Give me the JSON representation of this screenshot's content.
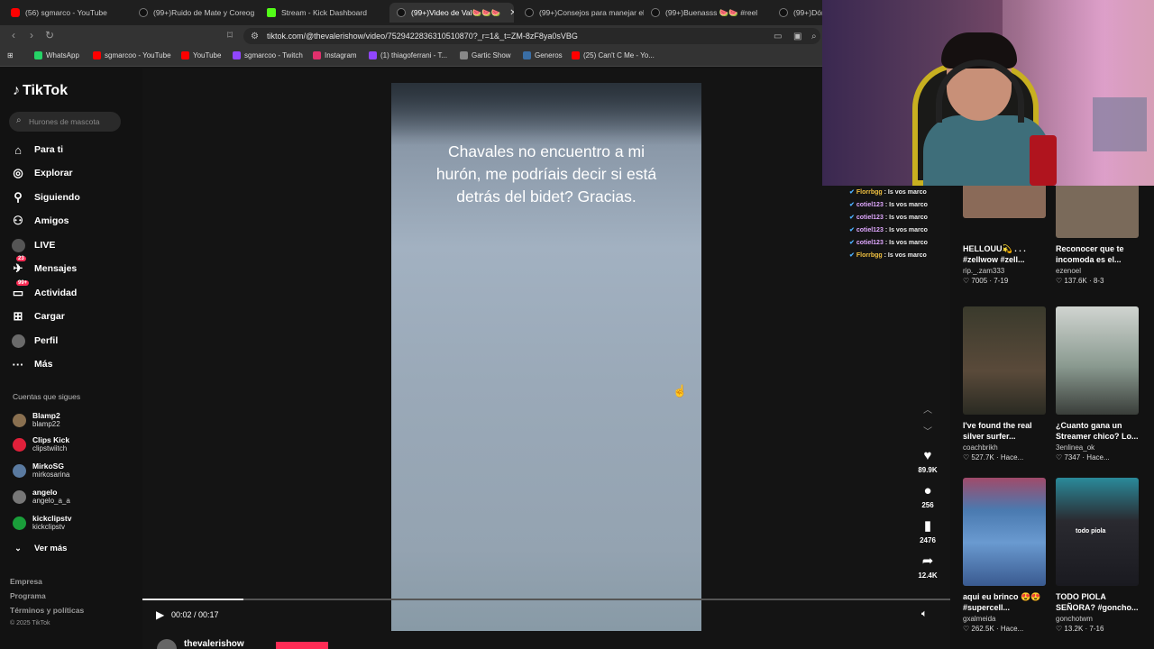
{
  "browser": {
    "tabs": [
      {
        "label": "(56) sgmarco - YouTube",
        "icon": "youtube-icon"
      },
      {
        "label": "(99+)Ruido de Mate y Coreog",
        "icon": "tiktok-icon"
      },
      {
        "label": "Stream - Kick Dashboard",
        "icon": "kick-icon"
      },
      {
        "label": "(99+)Video de Val🍉🍉🍉",
        "icon": "tiktok-icon",
        "active": true
      },
      {
        "label": "(99+)Consejos para manejar el",
        "icon": "tiktok-icon"
      },
      {
        "label": "(99+)Buenasss 🍉🍉 #reel",
        "icon": "tiktok-icon"
      },
      {
        "label": "(99+)Dór",
        "icon": "tiktok-icon"
      }
    ],
    "url": "tiktok.com/@thevalerishow/video/7529422836310510870?_r=1&_t=ZM-8zF8ya0sVBG",
    "bookmarks": [
      {
        "label": "WhatsApp",
        "color": "#25d366"
      },
      {
        "label": "sgmarcoo - YouTube",
        "color": "#ff0000"
      },
      {
        "label": "YouTube",
        "color": "#ff0000"
      },
      {
        "label": "sgmarcoo - Twitch",
        "color": "#9146ff"
      },
      {
        "label": "Instagram",
        "color": "#e1306c"
      },
      {
        "label": "(1) thiagoferrani - T...",
        "color": "#9146ff"
      },
      {
        "label": "Gartic Show",
        "color": "#888888"
      },
      {
        "label": "Generos",
        "color": "#3a6ea5"
      },
      {
        "label": "(25) Can't C Me - Yo...",
        "color": "#ff0000"
      }
    ]
  },
  "sidebar": {
    "logo": "TikTok",
    "search_placeholder": "Hurones de mascota",
    "nav": [
      {
        "label": "Para ti",
        "icon": "home-icon"
      },
      {
        "label": "Explorar",
        "icon": "compass-icon"
      },
      {
        "label": "Siguiendo",
        "icon": "person-plus-icon"
      },
      {
        "label": "Amigos",
        "icon": "friends-icon"
      },
      {
        "label": "LIVE",
        "icon": "live-icon"
      },
      {
        "label": "Mensajes",
        "icon": "message-icon",
        "badge": "23"
      },
      {
        "label": "Actividad",
        "icon": "inbox-icon",
        "badge": "99+"
      },
      {
        "label": "Cargar",
        "icon": "plus-box-icon"
      },
      {
        "label": "Perfil",
        "icon": "profile-avatar"
      },
      {
        "label": "Más",
        "icon": "ellipsis-icon"
      }
    ],
    "following_title": "Cuentas que sigues",
    "following": [
      {
        "name": "Blamp2",
        "handle": "blamp22",
        "color": "#8a7050"
      },
      {
        "name": "Clips Kick",
        "handle": "clipstwiitch",
        "color": "#e0203a"
      },
      {
        "name": "MirkoSG",
        "handle": "mirkosarina",
        "color": "#5a7aa0"
      },
      {
        "name": "angelo",
        "handle": "angelo_a_a",
        "color": "#777777"
      },
      {
        "name": "kickclipstv",
        "handle": "kickclipstv",
        "color": "#1a9e3a"
      }
    ],
    "see_more": "Ver más",
    "footer": [
      "Empresa",
      "Programa",
      "Términos y políticas",
      "© 2025 TikTok"
    ]
  },
  "video": {
    "caption": "Chavales no encuentro a mi hurón, me podríais decir si está detrás del bidet? Gracias.",
    "time": "00:02 / 00:17",
    "progress": 0.125,
    "author": "thevalerishow",
    "actions": {
      "likes": "89.9K",
      "comments": "256",
      "saves": "2476",
      "shares": "12.4K"
    }
  },
  "chat": [
    {
      "user": "Florrbgg",
      "msg": ": Is vos marco",
      "gold": true
    },
    {
      "user": "cotiel123",
      "msg": ": Is vos marco",
      "gold": false
    },
    {
      "user": "cotiel123",
      "msg": ": Is vos marco",
      "gold": false
    },
    {
      "user": "cotiel123",
      "msg": ": Is vos marco",
      "gold": false
    },
    {
      "user": "cotiel123",
      "msg": ": Is vos marco",
      "gold": false
    },
    {
      "user": "Florrbgg",
      "msg": ": Is vos marco",
      "gold": true
    }
  ],
  "related": [
    {
      "title": "HELLOUU💫 . . . #zellwow #zell...",
      "author": "rip._.zam333",
      "stats": "♡ 7005 · 7-19",
      "bg": "#8a6a58"
    },
    {
      "title": "Reconocer que te incomoda es el...",
      "author": "ezenoel",
      "stats": "♡ 137.6K · 8-3",
      "bg": "#7a6a5a"
    },
    {
      "title": "I've found the real silver surfer...",
      "author": "coachbrikh",
      "stats": "♡ 527.7K · Hace...",
      "bg": "#3a3a2c"
    },
    {
      "title": "¿Cuanto gana un Streamer chico? Lo...",
      "author": "3enlinea_ok",
      "stats": "♡ 7347 · Hace...",
      "bg": "#bfc3c0"
    },
    {
      "title": "aqui eu brinco 😍😍 #supercell...",
      "author": "gxalmeida",
      "stats": "♡ 262.5K · Hace...",
      "bg": "#4a7ab0"
    },
    {
      "title": "TODO PIOLA SEÑORA? #goncho...",
      "author": "gonchotwm",
      "stats": "♡ 13.2K · 7-16",
      "bg": "#2a2a30"
    }
  ],
  "related_overlay_1": "todo piola"
}
